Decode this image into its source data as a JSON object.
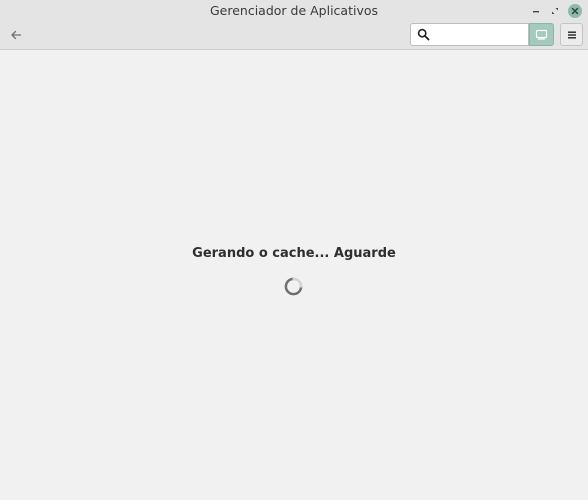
{
  "window": {
    "title": "Gerenciador de Aplicativos"
  },
  "toolbar": {
    "search": {
      "value": "",
      "placeholder": ""
    }
  },
  "main": {
    "loading_message": "Gerando o cache... Aguarde"
  },
  "colors": {
    "accent": "#a3cabd",
    "close_button": "#8fb9ad",
    "background": "#f1f1f1",
    "titlebar": "#e4e4e4"
  },
  "icons": {
    "back": "arrow-left-icon",
    "search": "search-icon",
    "filter": "filter-icon",
    "menu": "hamburger-menu-icon",
    "minimize": "minimize-icon",
    "maximize": "maximize-icon",
    "close": "close-icon",
    "spinner": "loading-spinner"
  }
}
